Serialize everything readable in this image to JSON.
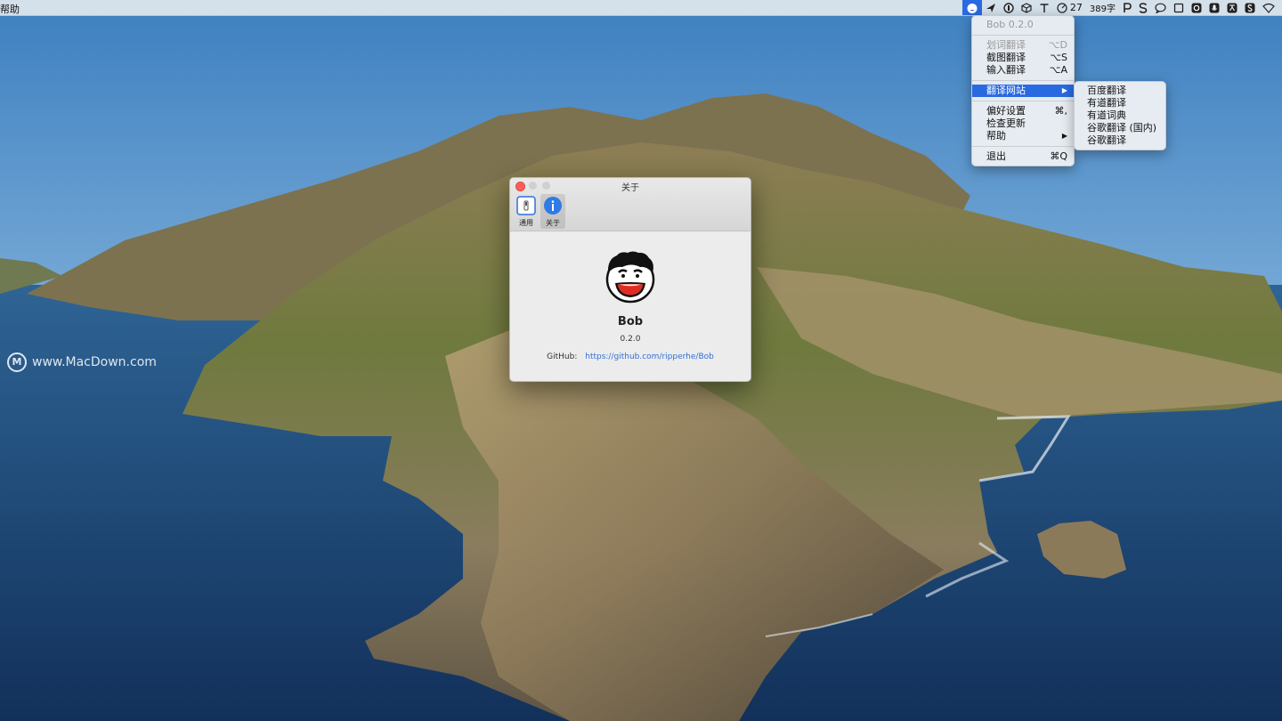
{
  "menubar": {
    "left_menu": "帮助",
    "status": {
      "counter": "27",
      "word_count": "389字"
    }
  },
  "main_menu": {
    "header": "Bob 0.2.0",
    "items": [
      {
        "label": "划词翻译",
        "shortcut": "⌥D",
        "disabled": true
      },
      {
        "label": "截图翻译",
        "shortcut": "⌥S"
      },
      {
        "label": "输入翻译",
        "shortcut": "⌥A"
      },
      {
        "label": "翻译网站",
        "shortcut": "▶",
        "highlighted": true
      },
      {
        "label": "偏好设置",
        "shortcut": "⌘,"
      },
      {
        "label": "检查更新",
        "shortcut": ""
      },
      {
        "label": "帮助",
        "shortcut": "▶"
      },
      {
        "label": "退出",
        "shortcut": "⌘Q"
      }
    ]
  },
  "sub_menu": {
    "items": [
      "百度翻译",
      "有道翻译",
      "有道词典",
      "谷歌翻译 (国内)",
      "谷歌翻译"
    ]
  },
  "about_window": {
    "title": "关于",
    "toolbar": {
      "general_label": "通用",
      "about_label": "关于"
    },
    "app_name": "Bob",
    "version": "0.2.0",
    "github_label": "GitHub:",
    "github_url": "https://github.com/ripperhe/Bob"
  },
  "watermark": {
    "text": "www.MacDown.com",
    "logo": "M"
  },
  "colors": {
    "accent": "#2a6ae0",
    "link": "#2f6fd6",
    "close_button": "#fc5f57"
  }
}
